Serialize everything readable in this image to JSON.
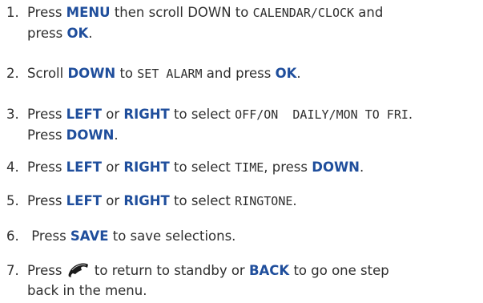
{
  "steps": [
    {
      "number": "1.",
      "lines": [
        [
          {
            "text": "Press ",
            "style": "plain"
          },
          {
            "text": "MENU",
            "style": "keyword"
          },
          {
            "text": " then scroll DOWN to ",
            "style": "plain"
          },
          {
            "text": "CALENDAR/CLOCK",
            "style": "display"
          },
          {
            "text": " and",
            "style": "plain"
          }
        ],
        [
          {
            "text": "press ",
            "style": "plain"
          },
          {
            "text": "OK",
            "style": "keyword"
          },
          {
            "text": ".",
            "style": "plain"
          }
        ]
      ]
    },
    {
      "number": "2.",
      "lines": [
        [
          {
            "text": "Scroll ",
            "style": "plain"
          },
          {
            "text": "DOWN",
            "style": "keyword"
          },
          {
            "text": " to ",
            "style": "plain"
          },
          {
            "text": "SET ALARM",
            "style": "display"
          },
          {
            "text": " and press ",
            "style": "plain"
          },
          {
            "text": "OK",
            "style": "keyword"
          },
          {
            "text": ".",
            "style": "plain"
          }
        ]
      ]
    },
    {
      "number": "3.",
      "lines": [
        [
          {
            "text": "Press ",
            "style": "plain"
          },
          {
            "text": "LEFT",
            "style": "keyword"
          },
          {
            "text": " or ",
            "style": "plain"
          },
          {
            "text": "RIGHT",
            "style": "keyword"
          },
          {
            "text": " to select ",
            "style": "plain"
          },
          {
            "text": "OFF/ON  DAILY/MON TO FRI",
            "style": "display"
          },
          {
            "text": ".",
            "style": "plain"
          }
        ],
        [
          {
            "text": "Press ",
            "style": "plain"
          },
          {
            "text": "DOWN",
            "style": "keyword"
          },
          {
            "text": ".",
            "style": "plain"
          }
        ]
      ]
    },
    {
      "number": "4.",
      "lines": [
        [
          {
            "text": "Press ",
            "style": "plain"
          },
          {
            "text": "LEFT",
            "style": "keyword"
          },
          {
            "text": " or ",
            "style": "plain"
          },
          {
            "text": "RIGHT",
            "style": "keyword"
          },
          {
            "text": " to select ",
            "style": "plain"
          },
          {
            "text": "TIME",
            "style": "display"
          },
          {
            "text": ", press ",
            "style": "plain"
          },
          {
            "text": "DOWN",
            "style": "keyword"
          },
          {
            "text": ".",
            "style": "plain"
          }
        ]
      ]
    },
    {
      "number": "5.",
      "lines": [
        [
          {
            "text": "Press ",
            "style": "plain"
          },
          {
            "text": "LEFT",
            "style": "keyword"
          },
          {
            "text": " or ",
            "style": "plain"
          },
          {
            "text": "RIGHT",
            "style": "keyword"
          },
          {
            "text": " to select ",
            "style": "plain"
          },
          {
            "text": "RINGTONE",
            "style": "display"
          },
          {
            "text": ".",
            "style": "plain"
          }
        ]
      ]
    },
    {
      "number": "6.",
      "lines": [
        [
          {
            "text": " Press ",
            "style": "plain"
          },
          {
            "text": "SAVE",
            "style": "keyword"
          },
          {
            "text": " to save selections.",
            "style": "plain"
          }
        ]
      ]
    },
    {
      "number": "7.",
      "lines": [
        [
          {
            "text": "Press ",
            "style": "plain"
          },
          {
            "icon": "end-call-icon"
          },
          {
            "text": " to return to standby or ",
            "style": "plain"
          },
          {
            "text": "BACK",
            "style": "keyword"
          },
          {
            "text": " to go one step",
            "style": "plain"
          }
        ],
        [
          {
            "text": "back in the menu.",
            "style": "plain"
          }
        ]
      ]
    }
  ],
  "colors": {
    "text": "#2e2e2e",
    "keyword": "#1f4e9c"
  }
}
